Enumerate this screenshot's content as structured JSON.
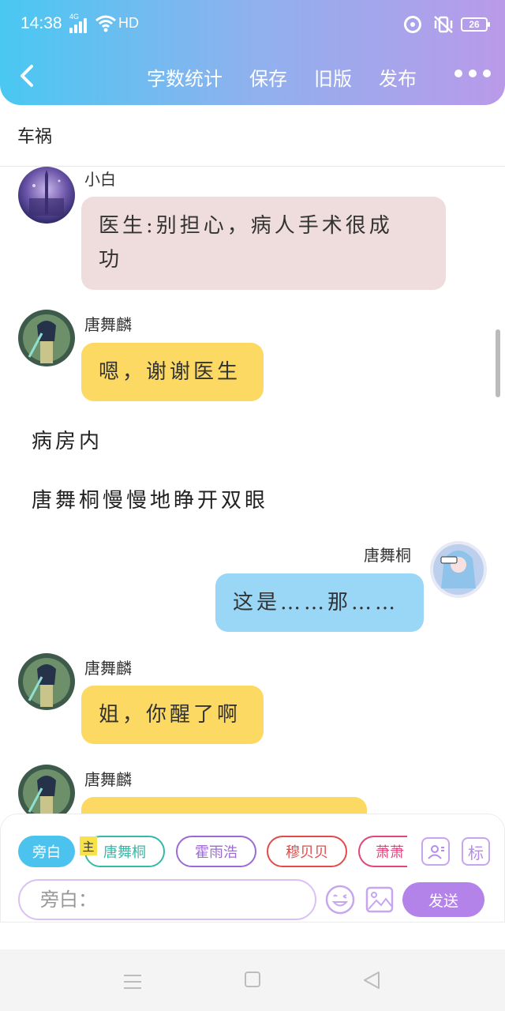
{
  "status_bar": {
    "time": "14:38",
    "network": "4G",
    "hd": "HD",
    "battery": "26"
  },
  "toolbar": {
    "word_count": "字数统计",
    "save": "保存",
    "old_version": "旧版",
    "publish": "发布"
  },
  "doc": {
    "title": "车祸"
  },
  "chat": [
    {
      "speaker": "小白",
      "text": "医生:别担心，病人手术很成功",
      "line1": "医生:别担心，病人手术很成",
      "line2": "功",
      "side": "left",
      "color": "#efdcdc"
    },
    {
      "speaker": "唐舞麟",
      "text": "嗯，谢谢医生",
      "side": "left",
      "color": "#fcd963"
    },
    {
      "narration": "病房内"
    },
    {
      "narration": "唐舞桐慢慢地睁开双眼"
    },
    {
      "speaker": "唐舞桐",
      "text": "这是……那……",
      "side": "right",
      "color": "#9ad6f5"
    },
    {
      "speaker": "唐舞麟",
      "text": "姐，你醒了啊",
      "side": "left",
      "color": "#fcd963"
    },
    {
      "speaker": "唐舞麟",
      "text": "",
      "side": "left",
      "color": "#fcd963"
    }
  ],
  "input_panel": {
    "role_chips": [
      {
        "label": "旁白",
        "active": true,
        "color": "#4cc3ef"
      },
      {
        "label": "唐舞桐",
        "color": "#35b9a8"
      },
      {
        "label": "霍雨浩",
        "color": "#9c6ad6"
      },
      {
        "label": "穆贝贝",
        "color": "#e14b4b"
      },
      {
        "label": "萧萧",
        "color": "#e0457b"
      }
    ],
    "main_badge": "主",
    "tag_button": "标",
    "input_placeholder": "旁白：",
    "send_label": "发送"
  },
  "colors": {
    "header_start": "#49c8f2",
    "header_end": "#b99ae9",
    "accent_purple": "#b383ea"
  }
}
